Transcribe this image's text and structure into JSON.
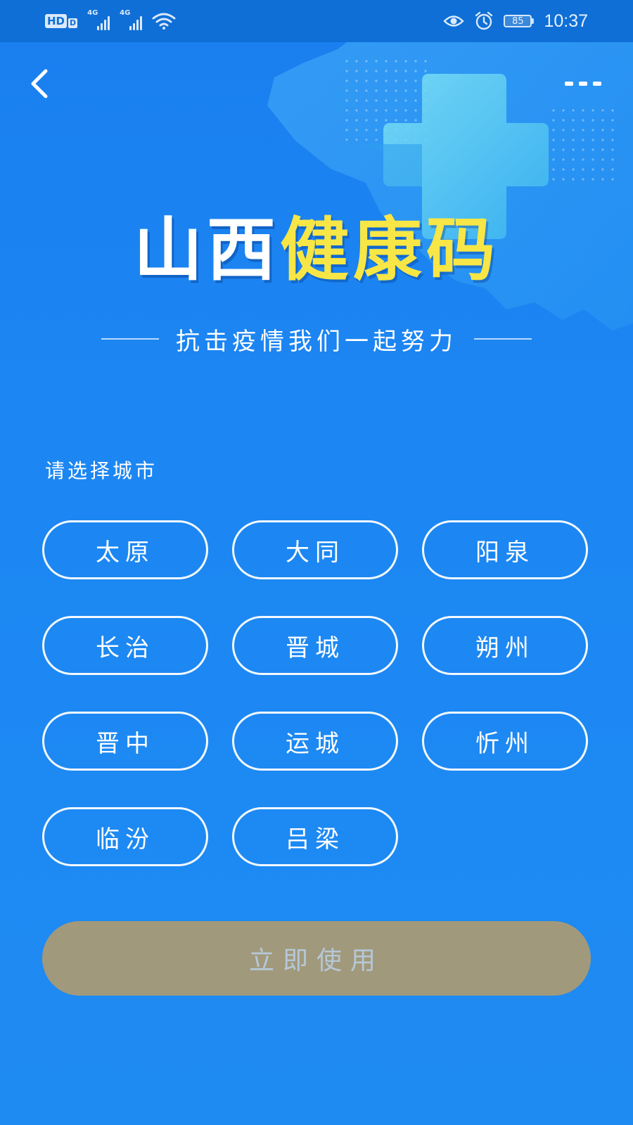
{
  "status_bar": {
    "hd_label": "HD",
    "hd_sub": "D",
    "network_1": "4G",
    "network_2": "4G",
    "battery": "85",
    "time": "10:37"
  },
  "header": {
    "title_white": "山西",
    "title_yellow": "健康码",
    "slogan": "抗击疫情我们一起努力"
  },
  "city_section": {
    "label": "请选择城市",
    "cities": [
      "太原",
      "大同",
      "阳泉",
      "长治",
      "晋城",
      "朔州",
      "晋中",
      "运城",
      "忻州",
      "临汾",
      "吕梁"
    ]
  },
  "actions": {
    "use_now": "立即使用"
  },
  "colors": {
    "background": "#1d89f3",
    "status_bar": "#0f6fd6",
    "title_yellow": "#f7e645",
    "use_button": "#a1997b",
    "use_button_text": "#b6c8d8"
  },
  "icons": {
    "back": "chevron-left-icon",
    "more": "more-dots-icon",
    "eye": "eye-icon",
    "alarm": "alarm-icon",
    "wifi": "wifi-icon",
    "signal": "signal-icon"
  }
}
